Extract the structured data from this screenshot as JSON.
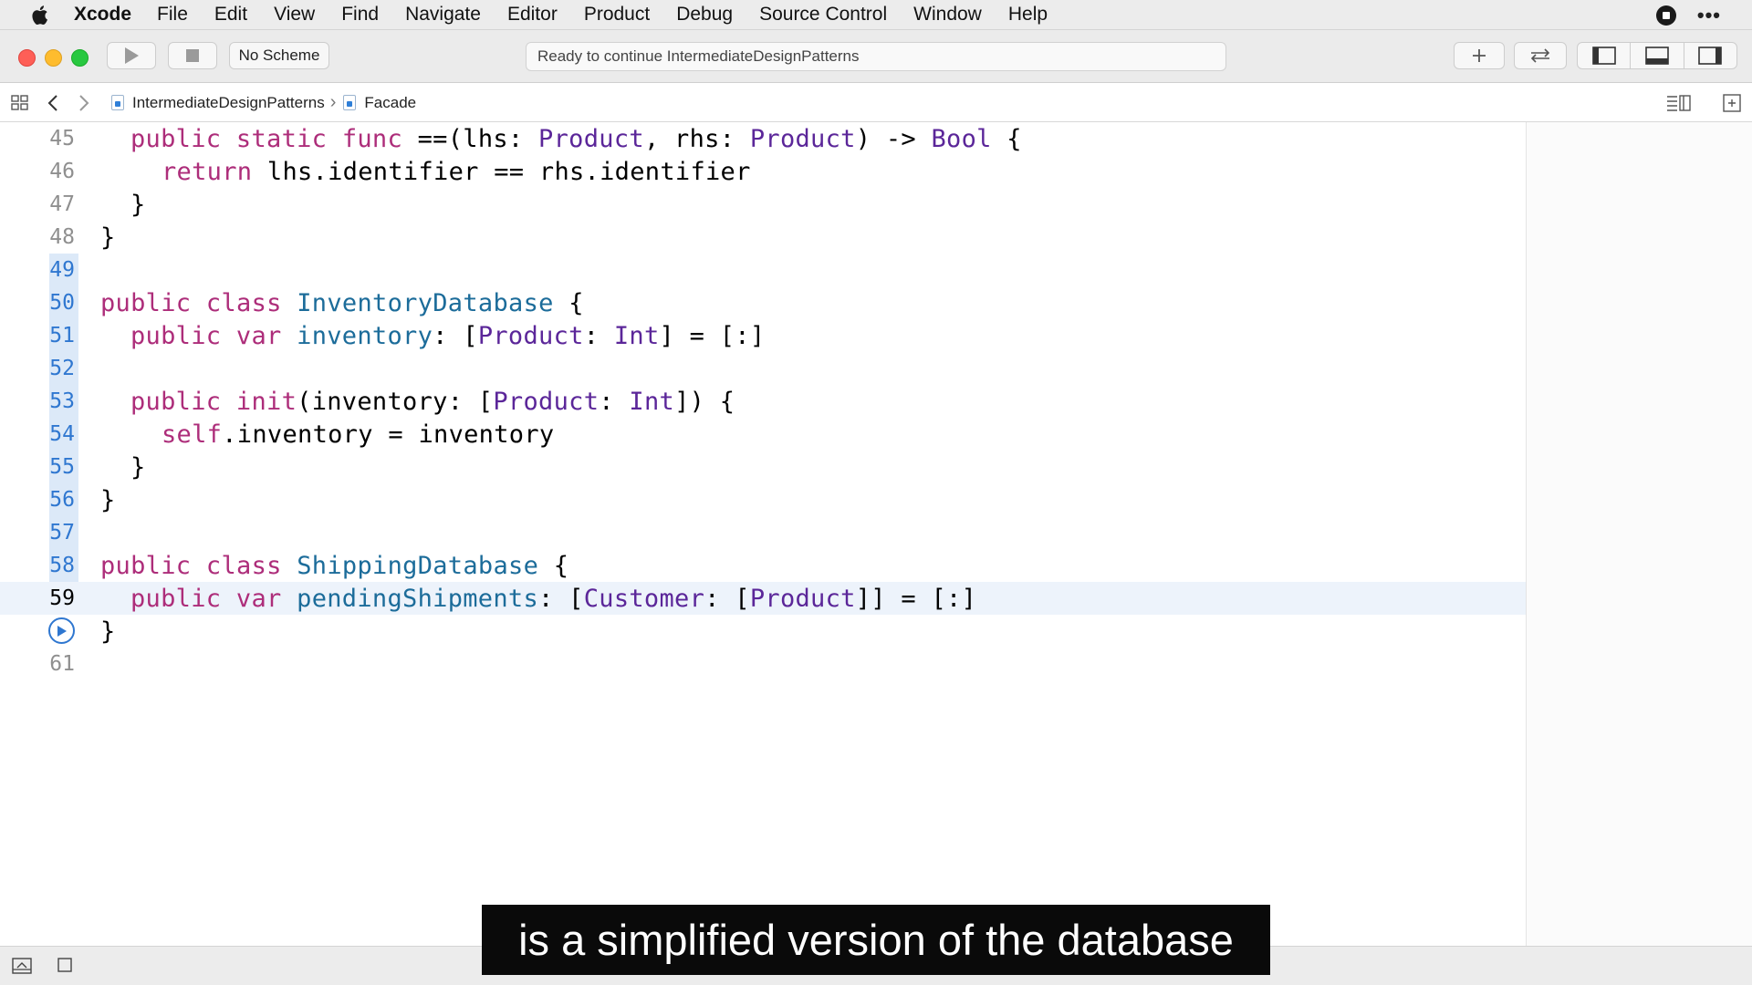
{
  "menubar": {
    "app_name": "Xcode",
    "items": [
      "File",
      "Edit",
      "View",
      "Find",
      "Navigate",
      "Editor",
      "Product",
      "Debug",
      "Source Control",
      "Window",
      "Help"
    ]
  },
  "toolbar": {
    "scheme_label": "No Scheme",
    "status_text": "Ready to continue IntermediateDesignPatterns"
  },
  "jumpbar": {
    "project": "IntermediateDesignPatterns",
    "file": "Facade"
  },
  "editor": {
    "lines": [
      {
        "number": "45",
        "text": "public static func ==(lhs: Product, rhs: Product) -> Bool {"
      },
      {
        "number": "46",
        "text": "return lhs.identifier == rhs.identifier"
      },
      {
        "number": "47",
        "text": "}"
      },
      {
        "number": "48",
        "text": "}"
      },
      {
        "number": "49",
        "text": ""
      },
      {
        "number": "50",
        "text": "public class InventoryDatabase {"
      },
      {
        "number": "51",
        "text": "public var inventory: [Product: Int] = [:]"
      },
      {
        "number": "52",
        "text": ""
      },
      {
        "number": "53",
        "text": "public init(inventory: [Product: Int]) {"
      },
      {
        "number": "54",
        "text": "self.inventory = inventory"
      },
      {
        "number": "55",
        "text": "}"
      },
      {
        "number": "56",
        "text": "}"
      },
      {
        "number": "57",
        "text": ""
      },
      {
        "number": "58",
        "text": "public class ShippingDatabase {"
      },
      {
        "number": "59",
        "text": "public var pendingShipments: [Customer: [Product]] = [:]"
      },
      {
        "number": "",
        "text": "}"
      },
      {
        "number": "61",
        "text": ""
      }
    ]
  },
  "caption": "is a simplified version of the database",
  "colors": {
    "keyword": "#ad2d7a",
    "type": "#5b2699",
    "declaration": "#1c6c9a",
    "changed_line_number": "#2f77d0",
    "current_line_bg": "#edf3fb"
  }
}
